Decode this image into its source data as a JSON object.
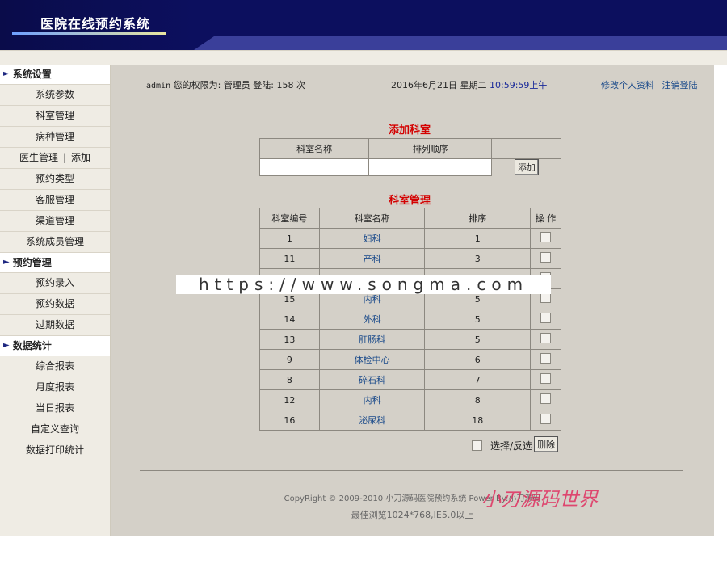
{
  "header": {
    "title": "医院在线预约系统"
  },
  "sidebar": {
    "sections": [
      {
        "title": "系统设置",
        "items": [
          "系统参数",
          "科室管理",
          "病种管理",
          "医生管理|添加",
          "预约类型",
          "客服管理",
          "渠道管理",
          "系统成员管理"
        ]
      },
      {
        "title": "预约管理",
        "items": [
          "预约录入",
          "预约数据",
          "过期数据"
        ]
      },
      {
        "title": "数据统计",
        "items": [
          "综合报表",
          "月度报表",
          "当日报表",
          "自定义查询",
          "数据打印统计"
        ]
      }
    ],
    "doctor_manage": "医生管理",
    "doctor_sep": "|",
    "doctor_add": "添加"
  },
  "info": {
    "user": "admin",
    "perm": "您的权限为: 管理员 登陆: 158 次",
    "date": "2016年6月21日 星期二",
    "time": "10:59:59上午",
    "link_profile": "修改个人资料",
    "link_logout": "注销登陆"
  },
  "add_section": {
    "title": "添加科室",
    "col_name": "科室名称",
    "col_order": "排列顺序",
    "add_button": "添加"
  },
  "manage_section": {
    "title": "科室管理",
    "headers": [
      "科室编号",
      "科室名称",
      "排序",
      "操 作"
    ],
    "rows": [
      {
        "id": "1",
        "name": "妇科",
        "order": "1"
      },
      {
        "id": "11",
        "name": "产科",
        "order": "3"
      },
      {
        "id": "",
        "name": "",
        "order": ""
      },
      {
        "id": "15",
        "name": "内科",
        "order": "5"
      },
      {
        "id": "14",
        "name": "外科",
        "order": "5"
      },
      {
        "id": "13",
        "name": "肛肠科",
        "order": "5"
      },
      {
        "id": "9",
        "name": "体检中心",
        "order": "6"
      },
      {
        "id": "8",
        "name": "碎石科",
        "order": "7"
      },
      {
        "id": "12",
        "name": "内科",
        "order": "8"
      },
      {
        "id": "16",
        "name": "泌尿科",
        "order": "18"
      }
    ],
    "select_label": "选择/反选",
    "delete_button": "删除"
  },
  "watermark": "https://www.songma.com",
  "footer": {
    "copyright": "CopyRight © 2009-2010 小刀源码医院预约系统 Power By:小刀源码",
    "browser": "最佳浏览1024*768,IE5.0以上",
    "brand": "小刃源码世界"
  }
}
